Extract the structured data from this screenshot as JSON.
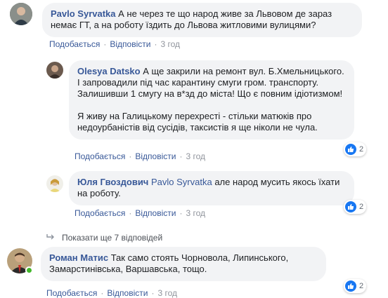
{
  "comments": [
    {
      "author": "Pavlo Syrvatka",
      "text": "А не через те що народ живе за Львовом де зараз немає ГТ, а на роботу їздить до Львова житловими вулицями?",
      "actions": {
        "like": "Подобається",
        "reply": "Відповісти",
        "time": "3 год"
      }
    }
  ],
  "replies": [
    {
      "author": "Olesya Datsko",
      "text_p1": "А ще закрили на ремонт вул. Б.Хмельницького. І запровадили під час карантину смуги гром. транспорту. Залишивши 1 смугу на в*зд до міста! Що є повним ідіотизмом!",
      "text_p2": "Я живу на Галицькому перехресті - стільки матюків про недоурбаністів від сусідів, таксистів я ще ніколи не чула.",
      "reactions": "2",
      "actions": {
        "like": "Подобається",
        "reply": "Відповісти",
        "time": "3 год"
      }
    },
    {
      "author": "Юля Гвоздович",
      "mention": "Pavlo Syrvatka",
      "text": "але народ мусить якось їхати на роботу.",
      "reactions": "2",
      "actions": {
        "like": "Подобається",
        "reply": "Відповісти",
        "time": "3 год"
      }
    }
  ],
  "show_more": "Показати ще 7 відповідей",
  "last_comment": {
    "author": "Роман Матис",
    "text": "Так само стоять Чорновола, Липинського, Замарстинівська, Варшавська, тощо.",
    "reactions": "2",
    "actions": {
      "like": "Подобається",
      "reply": "Відповісти",
      "time": "3 год"
    }
  },
  "colors": {
    "link": "#385898",
    "bubble": "#f2f3f5",
    "like": "#1877f2",
    "online": "#42b72a"
  }
}
